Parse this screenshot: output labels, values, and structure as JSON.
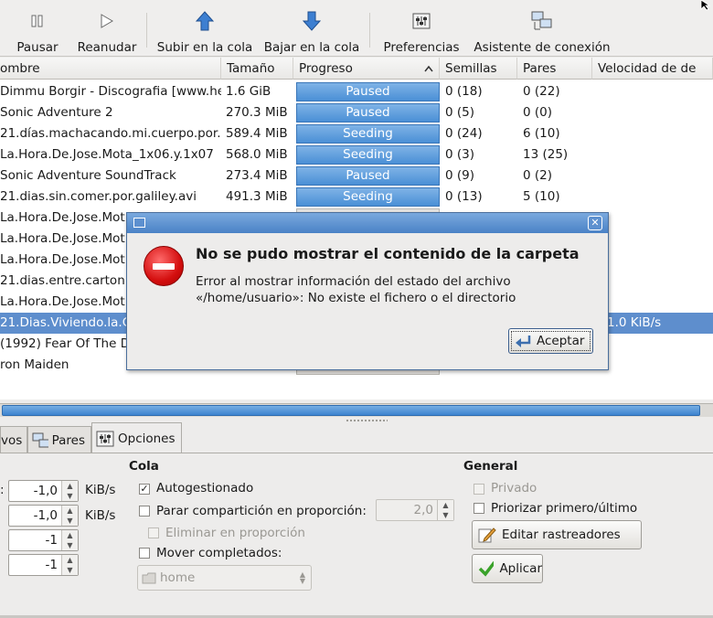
{
  "toolbar": {
    "pause": "Pausar",
    "resume": "Reanudar",
    "queue_up": "Subir en la cola",
    "queue_down": "Bajar en la cola",
    "preferences": "Preferencias",
    "wizard": "Asistente de conexión"
  },
  "columns": {
    "name": "ombre",
    "size": "Tamaño",
    "progress": "Progreso",
    "seeds": "Semillas",
    "peers": "Pares",
    "speed": "Velocidad de de"
  },
  "rows": [
    {
      "name": "Dimmu Borgir - Discografia [www.he",
      "size": "1.6 GiB",
      "progress": "Paused",
      "seeds": "0 (18)",
      "peers": "0 (22)"
    },
    {
      "name": "Sonic Adventure 2",
      "size": "270.3 MiB",
      "progress": "Paused",
      "seeds": "0 (5)",
      "peers": "0 (0)"
    },
    {
      "name": "21.días.machacando.mi.cuerpo.por.",
      "size": "589.4 MiB",
      "progress": "Seeding",
      "seeds": "0 (24)",
      "peers": "6 (10)"
    },
    {
      "name": "La.Hora.De.Jose.Mota_1x06.y.1x07",
      "size": "568.0 MiB",
      "progress": "Seeding",
      "seeds": "0 (3)",
      "peers": "13 (25)"
    },
    {
      "name": "Sonic Adventure SoundTrack",
      "size": "273.4 MiB",
      "progress": "Paused",
      "seeds": "0 (9)",
      "peers": "0 (2)"
    },
    {
      "name": "21.dias.sin.comer.por.galiley.avi",
      "size": "491.3 MiB",
      "progress": "Seeding",
      "seeds": "0 (13)",
      "peers": "5 (10)"
    },
    {
      "name": "La.Hora.De.Jose.Mot"
    },
    {
      "name": "La.Hora.De.Jose.Mot"
    },
    {
      "name": "La.Hora.De.Jose.Mot"
    },
    {
      "name": "21.dias.entre.carton"
    },
    {
      "name": "La.Hora.De.Jose.Mot"
    },
    {
      "name": "21.Dias.Viviendo.la.C",
      "speed": "1.0 KiB/s"
    },
    {
      "name": "(1992) Fear Of The D"
    },
    {
      "name": "ron Maiden"
    }
  ],
  "tabs": {
    "files": "vos",
    "peers": "Pares",
    "options": "Opciones"
  },
  "options": {
    "speed_unit": "KiB/s",
    "spin1": "-1,0",
    "spin2": "-1,0",
    "spin3": "-1",
    "spin4": "-1",
    "queue_title": "Cola",
    "auto_managed": "Autogestionado",
    "stop_ratio": "Parar compartición en proporción:",
    "ratio_value": "2,0",
    "remove_ratio": "Eliminar en proporción",
    "move_completed": "Mover completados:",
    "move_path": "home",
    "general_title": "General",
    "private": "Privado",
    "prioritize": "Priorizar primero/último",
    "edit_trackers": "Editar rastreadores",
    "apply": "Aplicar"
  },
  "dialog": {
    "heading": "No se pudo mostrar el contenido de la carpeta",
    "body": "Error al mostrar información del estado del archivo «/home/usuario»: No existe el fichero o el directorio",
    "ok": "Aceptar"
  }
}
